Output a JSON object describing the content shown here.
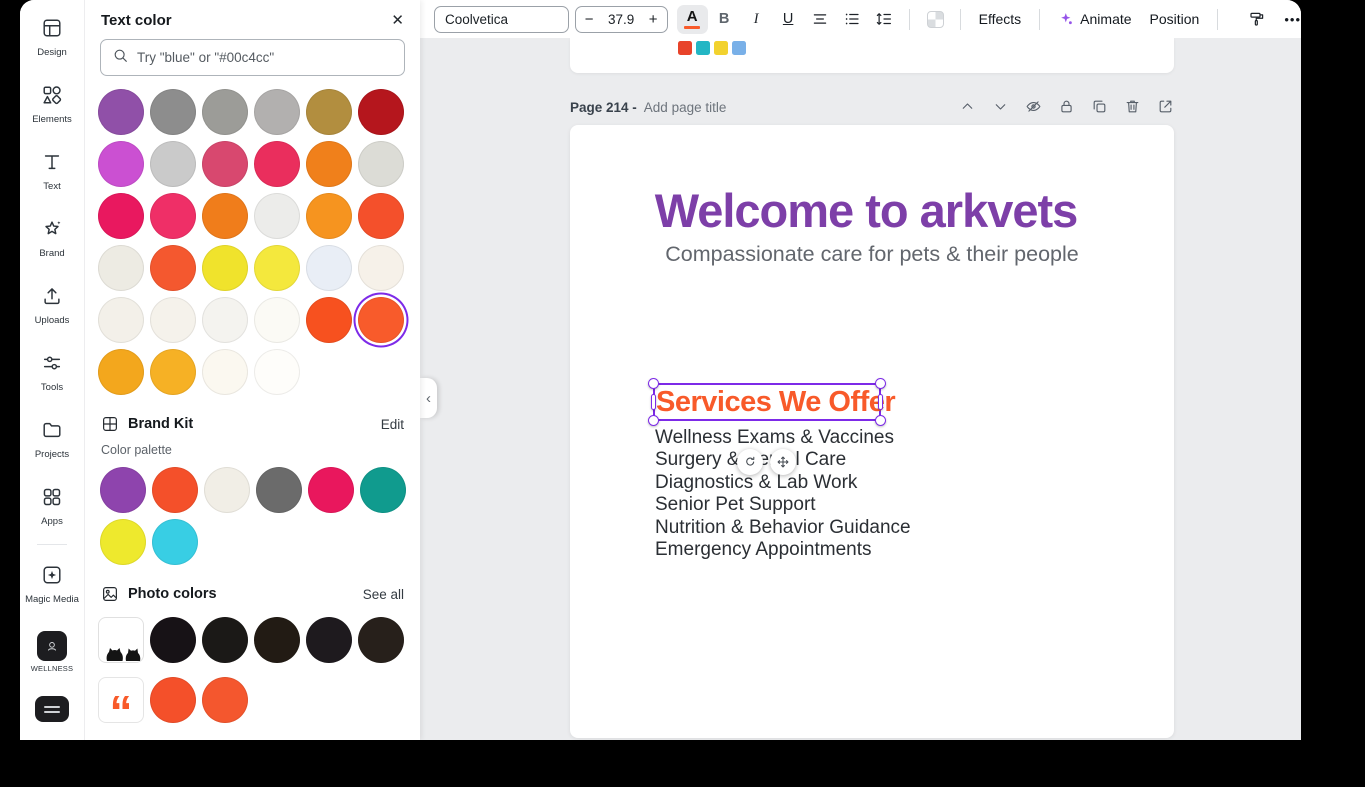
{
  "colors": {
    "selection_purple": "#7d2ae8",
    "heading_orange": "#f85a2a",
    "title_purple": "#7d3fa8",
    "subtitle_gray": "#62666d",
    "canvas_bg": "#ebecee"
  },
  "icons": {
    "close": "✕",
    "chevron_left": "‹",
    "quote": "“"
  },
  "sidebar": {
    "items": [
      {
        "label": "Design"
      },
      {
        "label": "Elements"
      },
      {
        "label": "Text"
      },
      {
        "label": "Brand"
      },
      {
        "label": "Uploads"
      },
      {
        "label": "Tools"
      },
      {
        "label": "Projects"
      },
      {
        "label": "Apps"
      },
      {
        "label": "Magic Media"
      },
      {
        "label": "WELLNESS"
      }
    ]
  },
  "panel": {
    "title": "Text color",
    "search_placeholder": "Try \"blue\" or \"#00c4cc\"",
    "document_colors": [
      "#9050a8",
      "#8d8d8d",
      "#9c9c98",
      "#b2b0af",
      "#b28e3f",
      "#b5161d",
      "#cb50d2",
      "#cacaca",
      "#d8486f",
      "#ea2e5d",
      "#f0801b",
      "#dcdcd6",
      "#e9185f",
      "#ef2f67",
      "#f07d1b",
      "#ececea",
      "#f6941f",
      "#f4502b",
      "#edebe3",
      "#f4582f",
      "#f0e32c",
      "#f4e83d",
      "#e9eef6",
      "#f6f1e9",
      "#f3f0e9",
      "#f5f2eb",
      "#f4f3ef",
      "#fbfaf5",
      "#f7511f",
      "#f85b2b",
      "#f3a71d",
      "#f6b125",
      "#fbf8f0",
      "#fefdfa"
    ],
    "selected_index": 29,
    "brand_kit": {
      "title": "Brand Kit",
      "edit_label": "Edit",
      "palette_label": "Color palette",
      "colors": [
        "#8e44ad",
        "#f4502a",
        "#f1eee6",
        "#6b6b6b",
        "#e9175d",
        "#109b8e",
        "#eee92d",
        "#38cee4"
      ]
    },
    "photo_colors": {
      "title": "Photo colors",
      "see_all_label": "See all",
      "colors": [
        "#171216",
        "#1b1917",
        "#221b14",
        "#1e1a1e",
        "#27201b"
      ],
      "partial_colors": [
        "#f4502a",
        "#f4572e"
      ]
    }
  },
  "toolbar": {
    "font_name": "Coolvetica",
    "font_size": "37.9",
    "minus": "−",
    "plus": "+",
    "text_color_glyph": "A",
    "bold": "B",
    "italic": "I",
    "underline": "U",
    "effects_label": "Effects",
    "animate_label": "Animate",
    "position_label": "Position",
    "more": "•••"
  },
  "page_bar": {
    "label": "Page 214 -",
    "title_placeholder": "Add page title"
  },
  "canvas": {
    "title": "Welcome to arkvets",
    "subtitle": "Compassionate care for pets & their people",
    "selected_heading": "Services We Offer",
    "services": [
      "Wellness Exams & Vaccines",
      "Surgery & Dental Care",
      "Diagnostics & Lab Work",
      "Senior Pet Support",
      "Nutrition & Behavior Guidance",
      "Emergency Appointments"
    ],
    "page_top_squares": [
      "#e8432a",
      "#23b6c4",
      "#f2d22e",
      "#79b0e8"
    ]
  }
}
